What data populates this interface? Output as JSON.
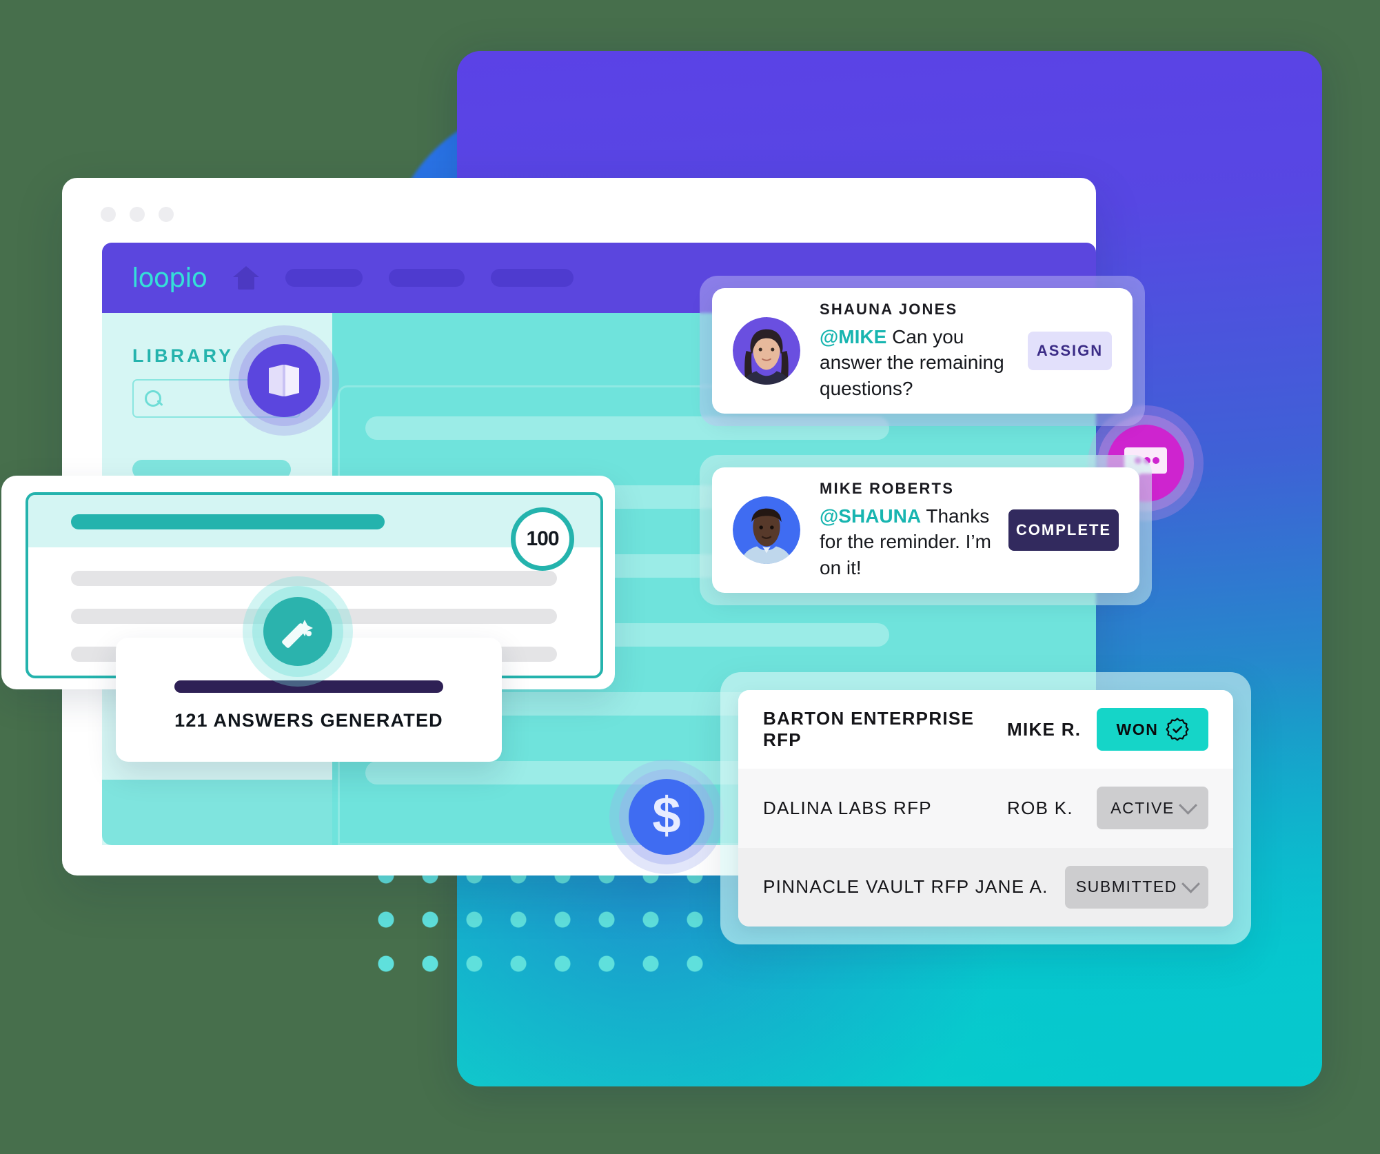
{
  "background": {
    "page_color": "#476F4C",
    "panel_gradient_from": "#5B42E6",
    "panel_gradient_mid": "#2A74E8",
    "panel_gradient_to": "#06CFC9"
  },
  "browser": {
    "dot_colors": [
      "#EDEDF0",
      "#EDEDF0",
      "#EDEDF0"
    ]
  },
  "app": {
    "brand": "loopio",
    "brand_color": "#34E0D8",
    "topbar_color": "#5B46DE",
    "home_icon": "home-icon",
    "nav_pills": [
      "",
      "",
      ""
    ],
    "sidebar": {
      "title": "LIBRARY",
      "title_color": "#24B3AD",
      "search_placeholder": "",
      "search_icon": "search-icon"
    }
  },
  "badges": {
    "library": {
      "icon": "book-icon",
      "color": "#5B46DE"
    },
    "magic": {
      "icon": "magic-wand-icon",
      "color": "#2BB3AD"
    },
    "chat": {
      "icon": "chat-bubble-icon",
      "color": "#CE24CF"
    },
    "money": {
      "icon": "dollar-icon",
      "glyph": "$",
      "color": "#3F6CF2"
    }
  },
  "answer_card": {
    "score": "100",
    "score_color": "#24B3AD",
    "lines": 3
  },
  "generated_card": {
    "label": "121 ANSWERS GENERATED",
    "progress_color": "#2E2055",
    "progress_percent": 100
  },
  "comments": [
    {
      "name": "SHAUNA JONES",
      "avatar": "shauna-jones-avatar",
      "mention": "@MIKE",
      "message": " Can you answer the remaining questions?",
      "action_label": "ASSIGN",
      "action_style": "light"
    },
    {
      "name": "MIKE ROBERTS",
      "avatar": "mike-roberts-avatar",
      "mention": "@SHAUNA",
      "message": " Thanks for the reminder. I’m on it!",
      "action_label": "COMPLETE",
      "action_style": "dark"
    }
  ],
  "rfp_table": {
    "rows": [
      {
        "name": "BARTON ENTERPRISE RFP",
        "owner": "MIKE R.",
        "status": "WON",
        "status_style": "won",
        "has_verified_badge": true
      },
      {
        "name": "DALINA LABS RFP",
        "owner": "ROB K.",
        "status": "ACTIVE",
        "status_style": "grey",
        "has_chevron": true
      },
      {
        "name": "PINNACLE VAULT RFP",
        "owner": "JANE A.",
        "status": "SUBMITTED",
        "status_style": "grey",
        "has_chevron": true
      }
    ],
    "won_color": "#15D5C8",
    "grey_color": "#CDCDCF"
  }
}
